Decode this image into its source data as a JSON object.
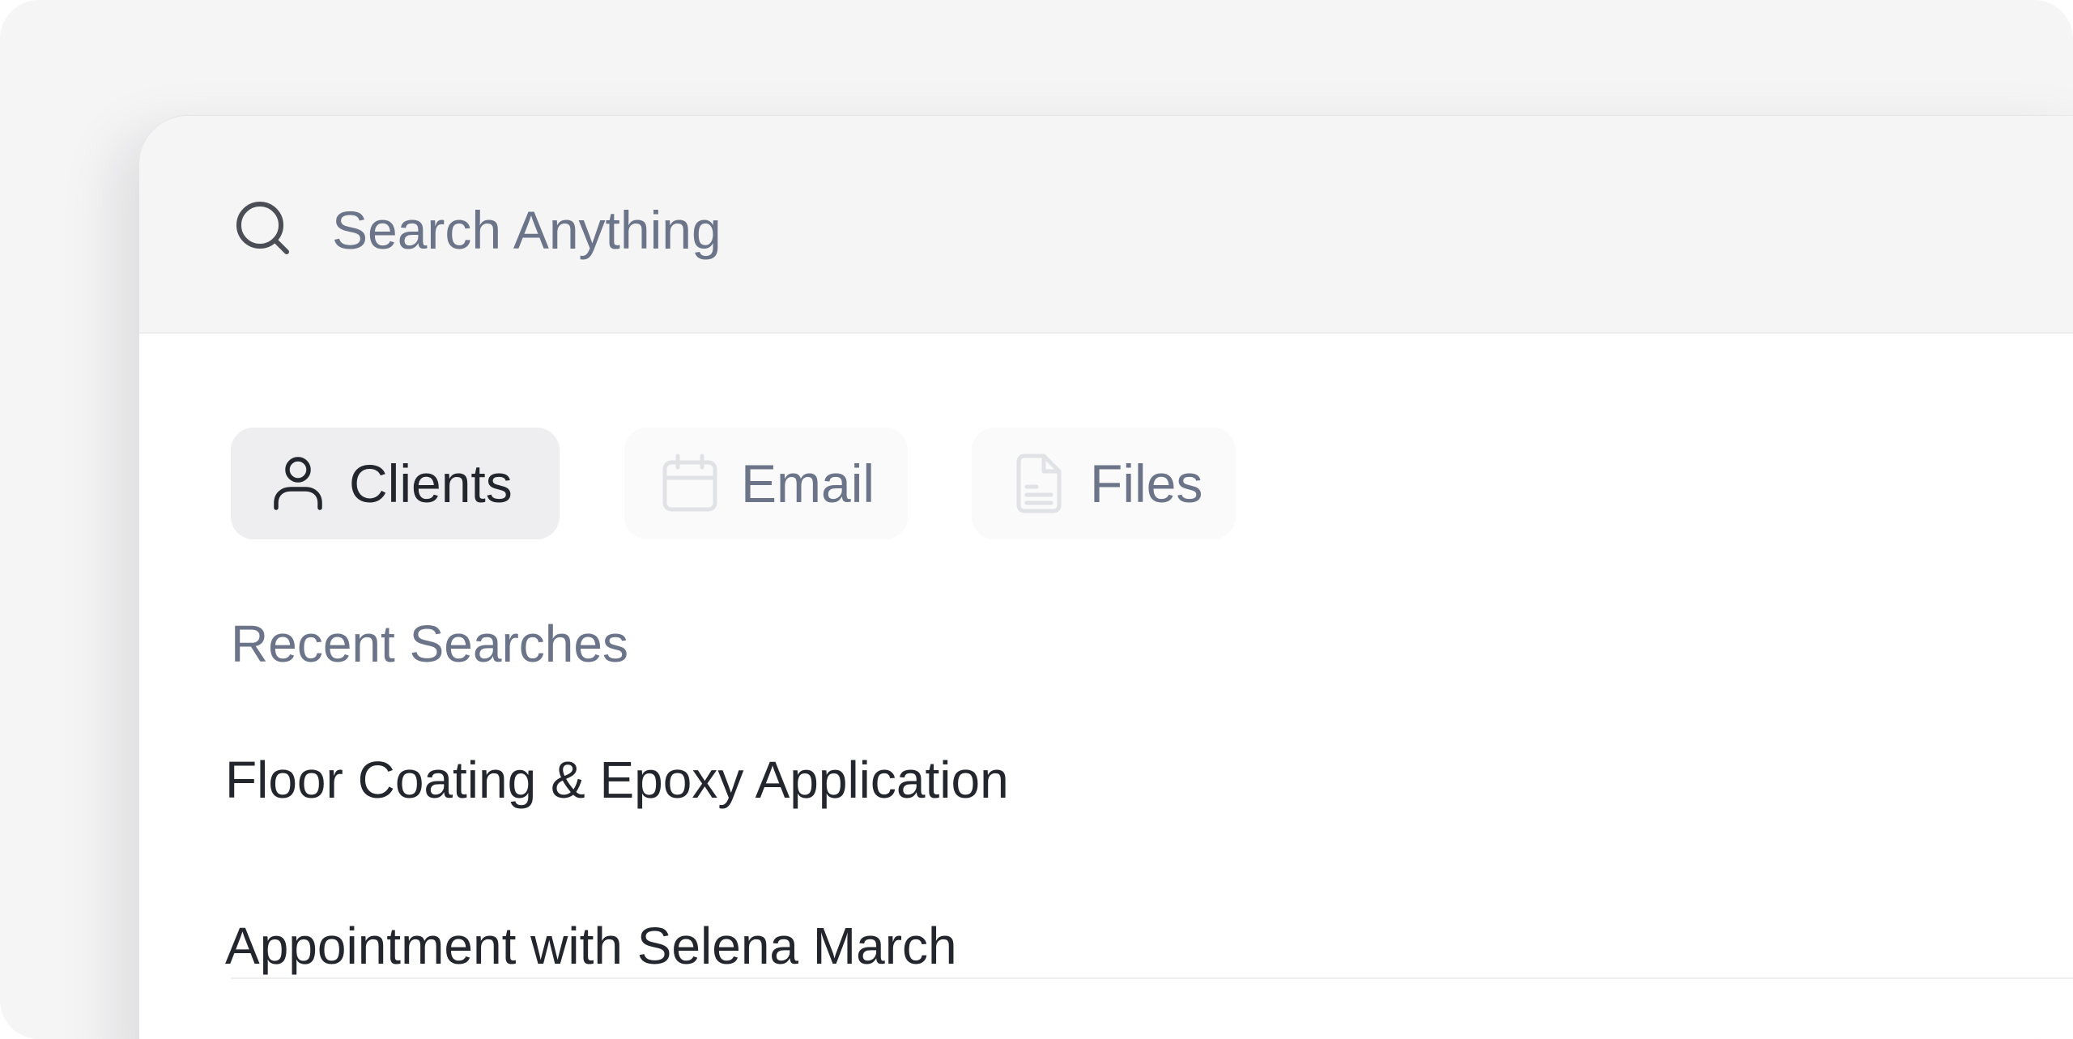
{
  "search": {
    "placeholder": "Search Anything",
    "icon": "search-icon"
  },
  "filters": [
    {
      "label": "Clients",
      "icon": "user-icon",
      "active": true
    },
    {
      "label": "Email",
      "icon": "calendar-icon",
      "active": false
    },
    {
      "label": "Files",
      "icon": "document-icon",
      "active": false
    }
  ],
  "recent": {
    "title": "Recent Searches",
    "items": [
      "Floor Coating & Epoxy Application",
      "Appointment with Selena March"
    ]
  },
  "colors": {
    "text_primary": "#23262d",
    "text_muted": "#6b7489",
    "header_bg": "#f5f5f5",
    "chip_active_bg": "#eeeef0",
    "chip_inactive_bg": "#fafafa"
  }
}
